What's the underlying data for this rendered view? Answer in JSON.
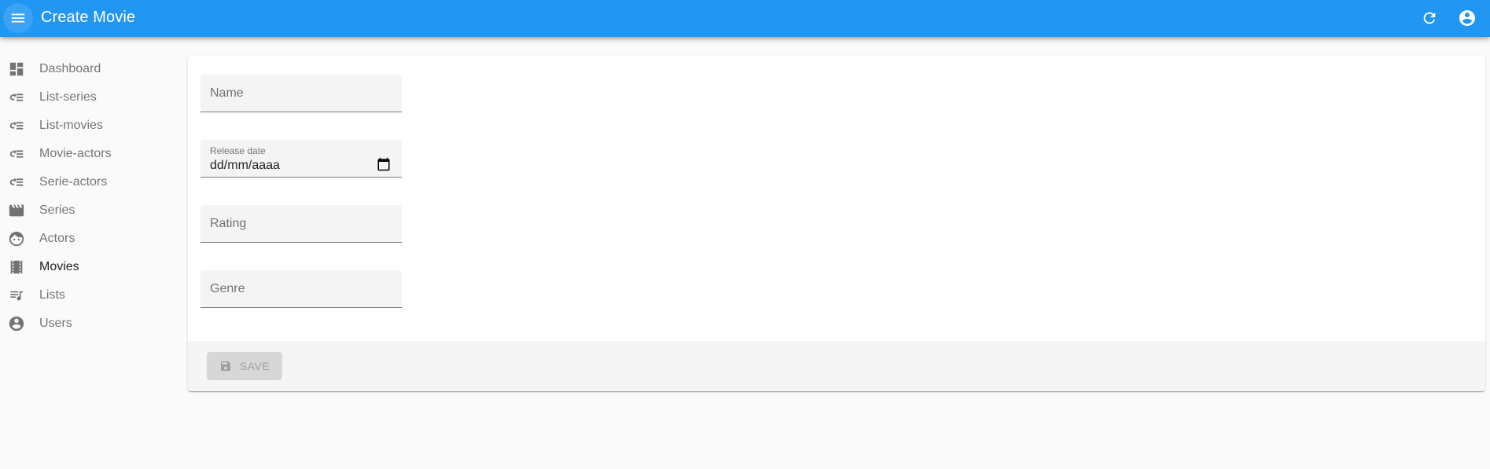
{
  "appbar": {
    "title": "Create Movie",
    "icons": {
      "menu": "menu-icon",
      "refresh": "refresh-icon",
      "account": "account-circle-icon"
    },
    "color": "#2196f3"
  },
  "sidebar": {
    "items": [
      {
        "label": "Dashboard",
        "icon": "dashboard-icon"
      },
      {
        "label": "List-series",
        "icon": "list-icon"
      },
      {
        "label": "List-movies",
        "icon": "list-icon"
      },
      {
        "label": "Movie-actors",
        "icon": "list-icon"
      },
      {
        "label": "Serie-actors",
        "icon": "list-icon"
      },
      {
        "label": "Series",
        "icon": "movie-clapper-icon"
      },
      {
        "label": "Actors",
        "icon": "face-icon"
      },
      {
        "label": "Movies",
        "icon": "local-movies-icon",
        "active": true
      },
      {
        "label": "Lists",
        "icon": "playlist-icon"
      },
      {
        "label": "Users",
        "icon": "account-circle-icon"
      }
    ]
  },
  "form": {
    "name": {
      "placeholder": "Name"
    },
    "release_date": {
      "label": "Release date",
      "value": "dd/mm/aaaa"
    },
    "rating": {
      "placeholder": "Rating"
    },
    "genre": {
      "placeholder": "Genre"
    }
  },
  "toolbar": {
    "save_label": "SAVE"
  }
}
